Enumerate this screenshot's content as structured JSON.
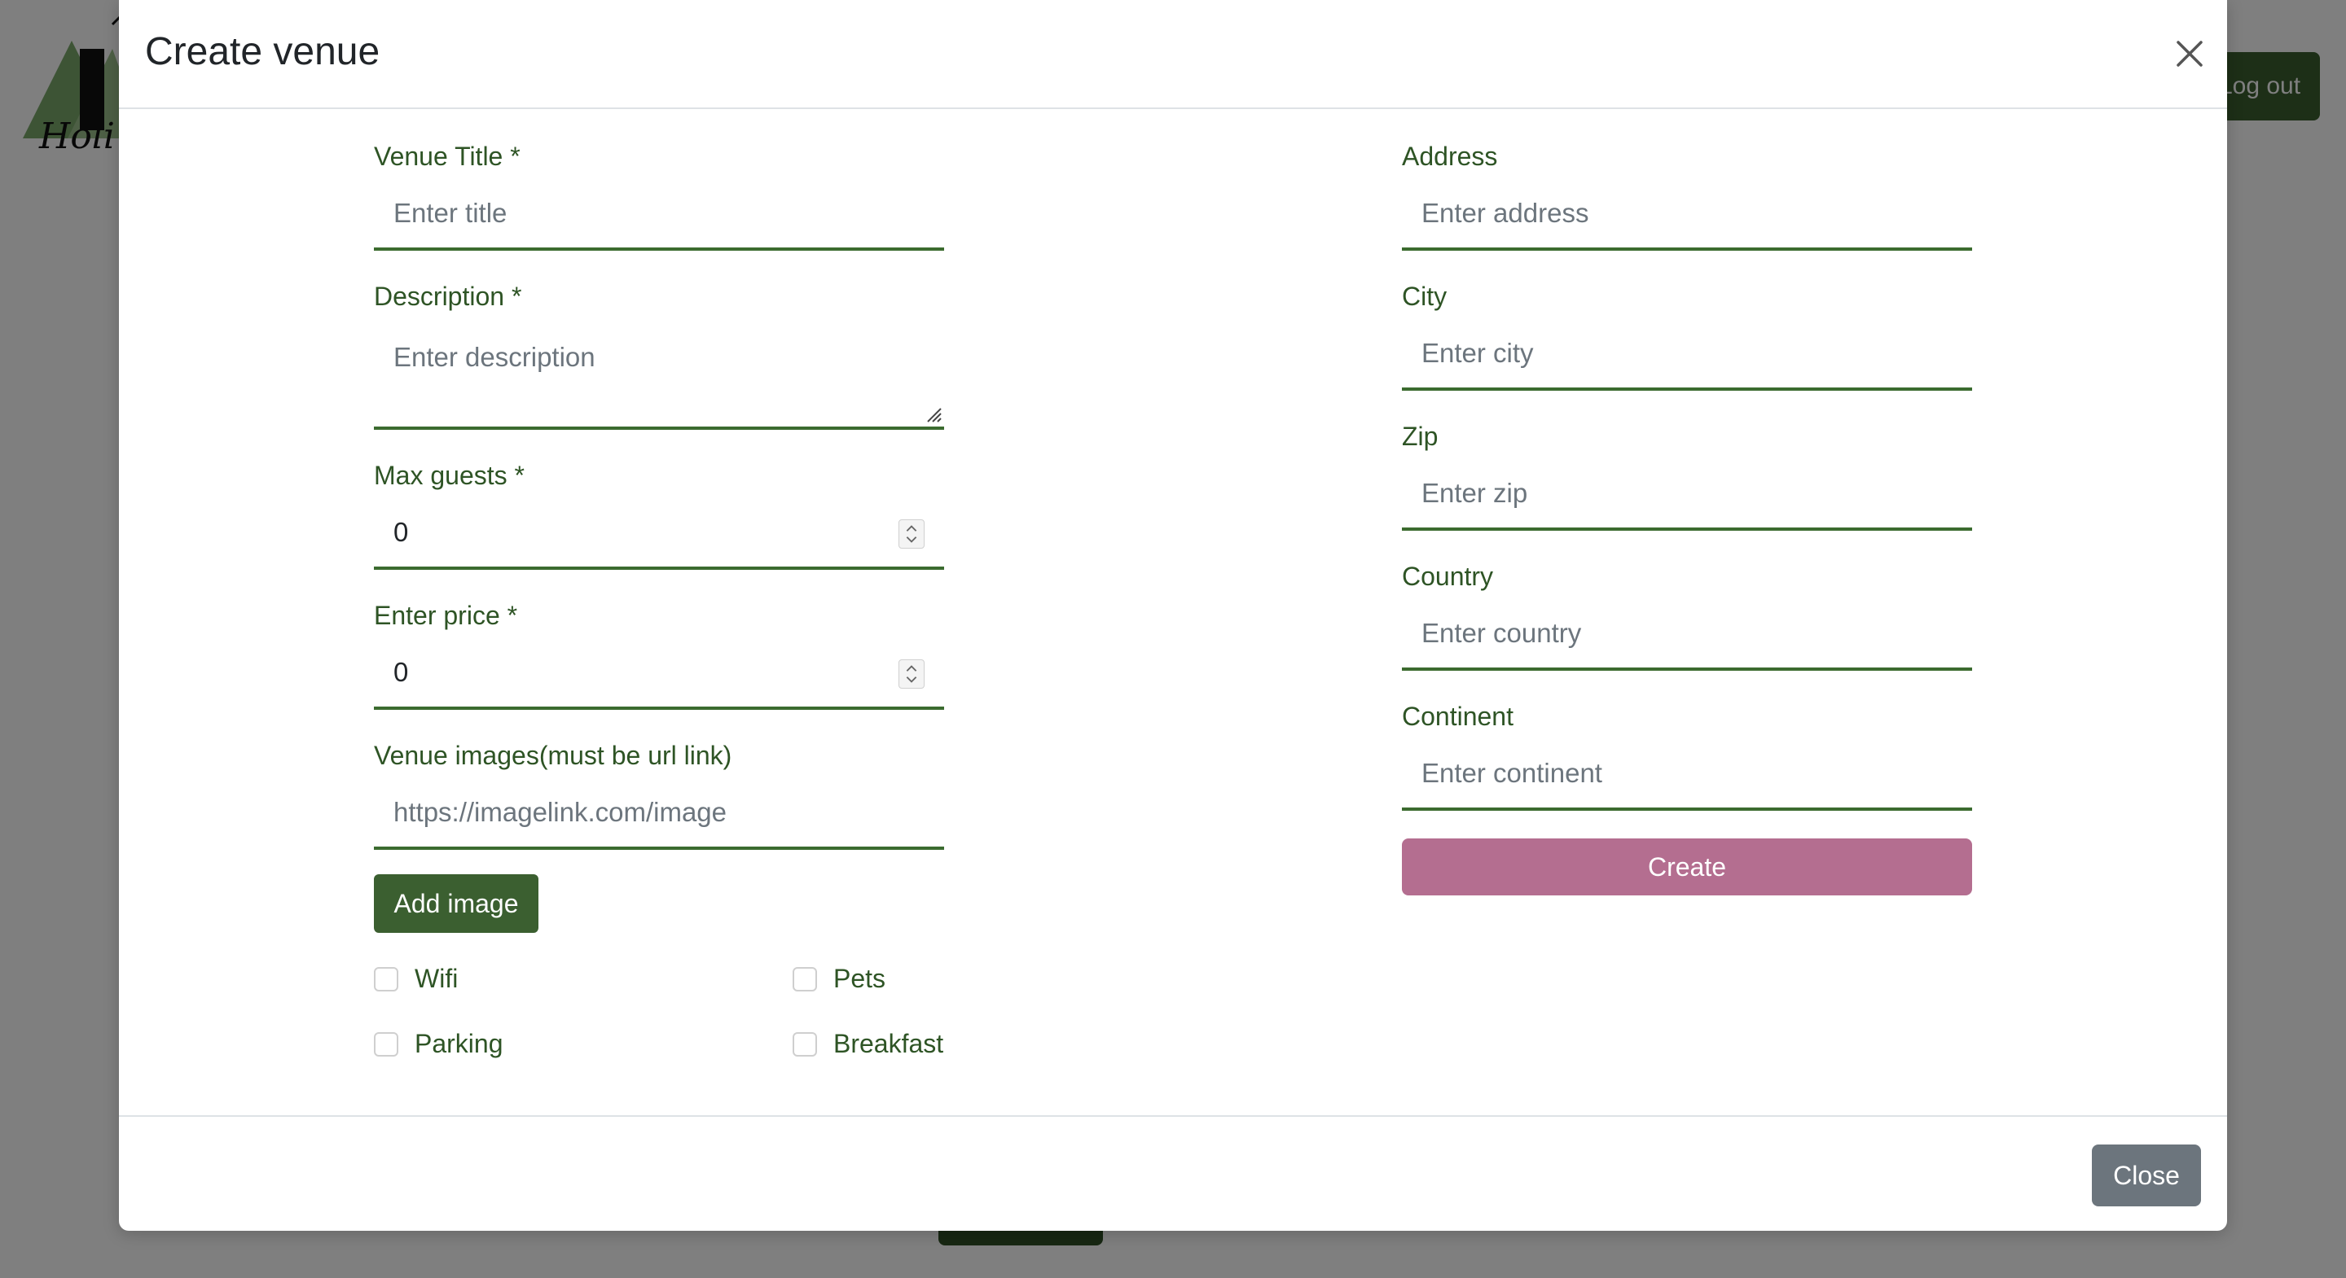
{
  "background": {
    "logo_text": "Holi",
    "logout_label": "Log out"
  },
  "modal": {
    "title": "Create venue",
    "close_footer_label": "Close"
  },
  "form": {
    "venue_title": {
      "label": "Venue Title *",
      "placeholder": "Enter title"
    },
    "description": {
      "label": "Description *",
      "placeholder": "Enter description"
    },
    "max_guests": {
      "label": "Max guests *",
      "value": "0"
    },
    "price": {
      "label": "Enter price *",
      "value": "0"
    },
    "images": {
      "label": "Venue images(must be url link)",
      "placeholder": "https://imagelink.com/image"
    },
    "add_image_label": "Add image",
    "amenities": [
      {
        "label": "Wifi",
        "checked": false
      },
      {
        "label": "Pets",
        "checked": false
      },
      {
        "label": "Parking",
        "checked": false
      },
      {
        "label": "Breakfast",
        "checked": false
      }
    ],
    "address": {
      "label": "Address",
      "placeholder": "Enter address"
    },
    "city": {
      "label": "City",
      "placeholder": "Enter city"
    },
    "zip": {
      "label": "Zip",
      "placeholder": "Enter zip"
    },
    "country": {
      "label": "Country",
      "placeholder": "Enter country"
    },
    "continent": {
      "label": "Continent",
      "placeholder": "Enter continent"
    },
    "create_label": "Create"
  },
  "colors": {
    "label_green": "#2e5425",
    "field_border": "#3b6b2f",
    "primary_button": "#3b5f30",
    "create_button": "#b46e90",
    "secondary_button": "#6c757d"
  }
}
